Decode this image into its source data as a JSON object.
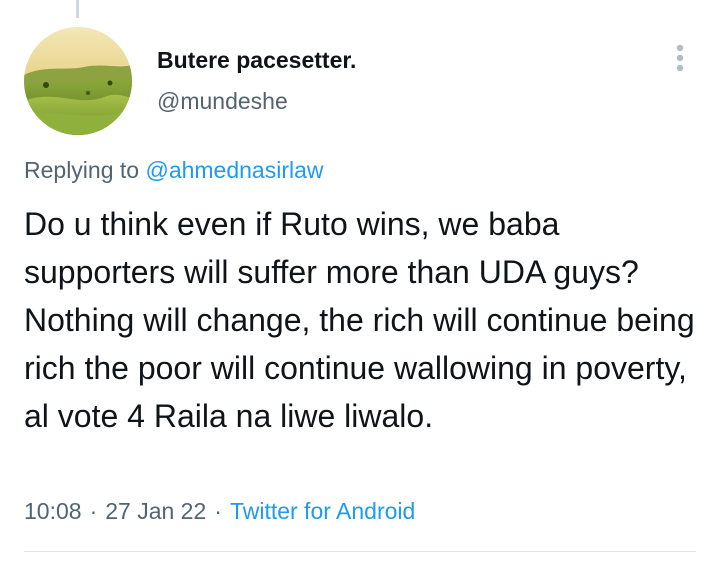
{
  "tweet": {
    "author": {
      "display_name": "Butere pacesetter.",
      "handle": "@mundeshe",
      "avatar": "avatar-landscape-icon"
    },
    "more_icon": "vertical-ellipsis-icon",
    "replying_prefix": "Replying to",
    "replying_to": "@ahmednasirlaw",
    "text": "Do u think even if Ruto wins, we baba supporters will suffer more than UDA guys? Nothing will change, the rich will continue being rich the poor will continue wallowing in poverty, al vote 4 Raila na liwe liwalo.",
    "time": "10:08",
    "date": "27 Jan 22",
    "separator": "·",
    "source": "Twitter for Android"
  },
  "colors": {
    "primary_text": "#0f1419",
    "secondary_text": "#536471",
    "link": "#1d9bf0",
    "divider": "#dfe4e8"
  }
}
